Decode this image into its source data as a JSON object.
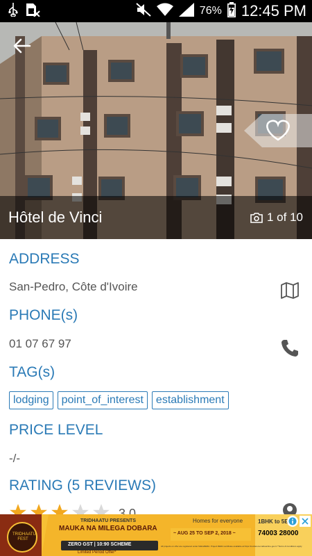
{
  "status_bar": {
    "battery_percent": "76%",
    "time": "12:45 PM"
  },
  "hero": {
    "hotel_name": "Hôtel de Vinci",
    "photo_count": "1 of 10"
  },
  "details": {
    "address_title": "ADDRESS",
    "address_value": "San-Pedro, Côte d'Ivoire",
    "phone_title": "PHONE(s)",
    "phone_value": "01 07 67 97",
    "tags_title": "TAG(s)",
    "tags": [
      "lodging",
      "point_of_interest",
      "establishment"
    ],
    "price_title": "PRICE LEVEL",
    "price_value": "-/-",
    "rating_title": "RATING (5 REVIEWS)",
    "rating_value": "3.0",
    "rating_stars": 3
  },
  "ad": {
    "presenter": "TRIDHAATU PRESENTS",
    "headline": "MAUKA NA MILEGA DOBARA",
    "scheme": "ZERO GST | 10:90 SCHEME",
    "offer": "Limited Period Offer*",
    "homes": "Homes for everyone",
    "dates": "~ AUG 25 TO SEP 2, 2018 ~",
    "bhk": "1BHK to 5B",
    "phone": "74003 28000",
    "fine_print": "All projects on offer are registered under MahaRERA. Project RERA certificate available at https://maharera.mahaonline.gov.in *Terms & Conditions apply",
    "badge": "TRIDHAATU FEST"
  },
  "colors": {
    "accent": "#2a7ab6",
    "star": "#f2a81e",
    "ad_background": "#f7c035"
  }
}
